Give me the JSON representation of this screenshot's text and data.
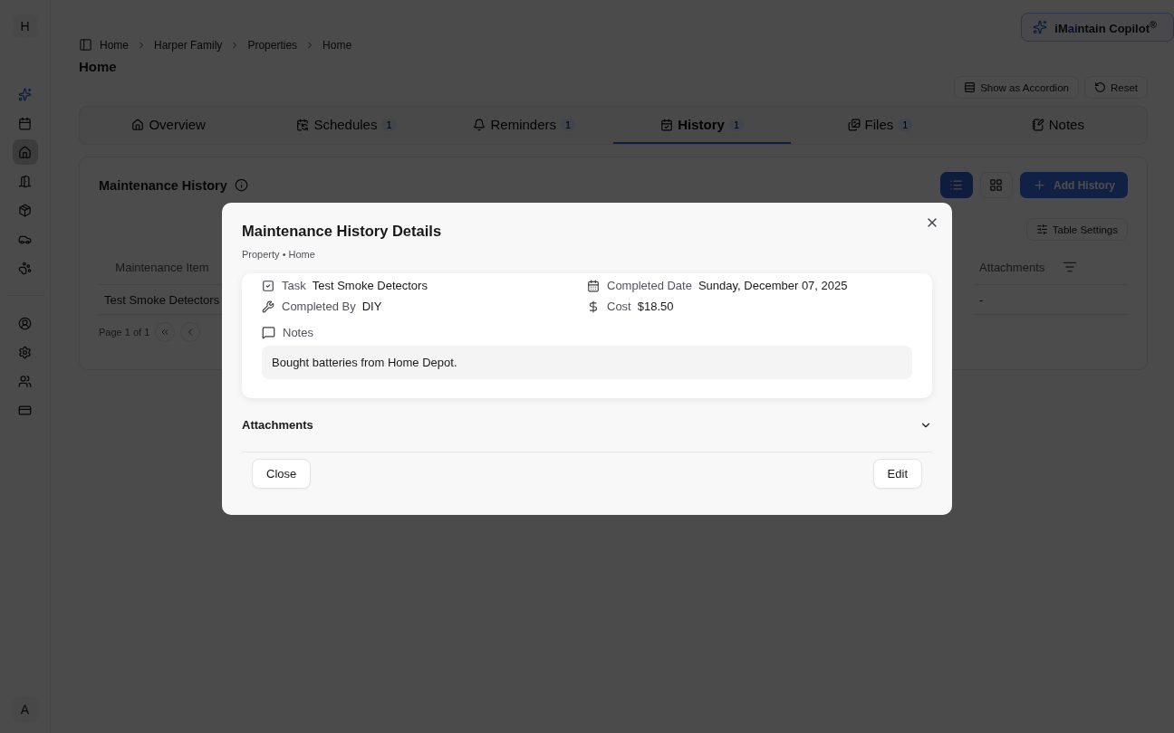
{
  "sidebar": {
    "logo": "H",
    "items": [
      {
        "kind": "copilot",
        "selected": false
      },
      {
        "kind": "calendar",
        "selected": false
      },
      {
        "kind": "home",
        "selected": true
      },
      {
        "kind": "building",
        "selected": false
      },
      {
        "kind": "box",
        "selected": false
      },
      {
        "kind": "car",
        "selected": false
      },
      {
        "kind": "paw",
        "selected": false
      }
    ],
    "bottom_items": [
      {
        "kind": "account"
      },
      {
        "kind": "settings"
      },
      {
        "kind": "users"
      },
      {
        "kind": "billing"
      }
    ],
    "avatar": "A"
  },
  "copilot": {
    "prefix": "iM",
    "highlight": "ai",
    "suffix": "ntain Copilot$^{®}$"
  },
  "breadcrumb": [
    "Home",
    "Harper Family",
    "Properties",
    "Home"
  ],
  "page_title": "Home",
  "actions": [
    {
      "kind": "accordion",
      "label": "Show as Accordion"
    },
    {
      "kind": "reset",
      "label": "Reset"
    }
  ],
  "tabs": [
    {
      "kind": "overview",
      "label": "Overview",
      "selected": false
    },
    {
      "kind": "schedules",
      "label": "Schedules",
      "count": "1",
      "selected": false
    },
    {
      "kind": "reminders",
      "label": "Reminders",
      "count": "1",
      "selected": false
    },
    {
      "kind": "history",
      "label": "History",
      "count": "1",
      "selected": true
    },
    {
      "kind": "files",
      "label": "Files",
      "count": "1",
      "selected": false
    },
    {
      "kind": "notes",
      "label": "Notes",
      "selected": false
    }
  ],
  "history": {
    "title": "Maintenance History",
    "views": [
      {
        "kind": "list",
        "selected": true
      },
      {
        "kind": "grid",
        "selected": false
      }
    ],
    "add_button": "Add History",
    "table_settings": "Table Settings",
    "columns": [
      "Maintenance Item",
      "Attachments"
    ],
    "rows": [
      [
        "Test Smoke Detectors",
        "-"
      ]
    ],
    "pagination": "Page 1 of 1"
  },
  "dialog": {
    "title": "Maintenance History Details",
    "subtitle": "Property • Home",
    "fields": [
      {
        "kind": "task",
        "label": "Task",
        "value": "Test Smoke Detectors"
      },
      {
        "kind": "date",
        "label": "Completed Date",
        "value": "Sunday, December 07, 2025"
      },
      {
        "kind": "by",
        "label": "Completed By",
        "value": "DIY"
      },
      {
        "kind": "cost",
        "label": "Cost",
        "value": "$18.50"
      }
    ],
    "notes_label": "Notes",
    "notes": "Bought batteries from Home Depot.",
    "attachments": {
      "label": "Attachments",
      "expanded": false
    },
    "buttons": [
      "Close",
      "Edit"
    ]
  }
}
